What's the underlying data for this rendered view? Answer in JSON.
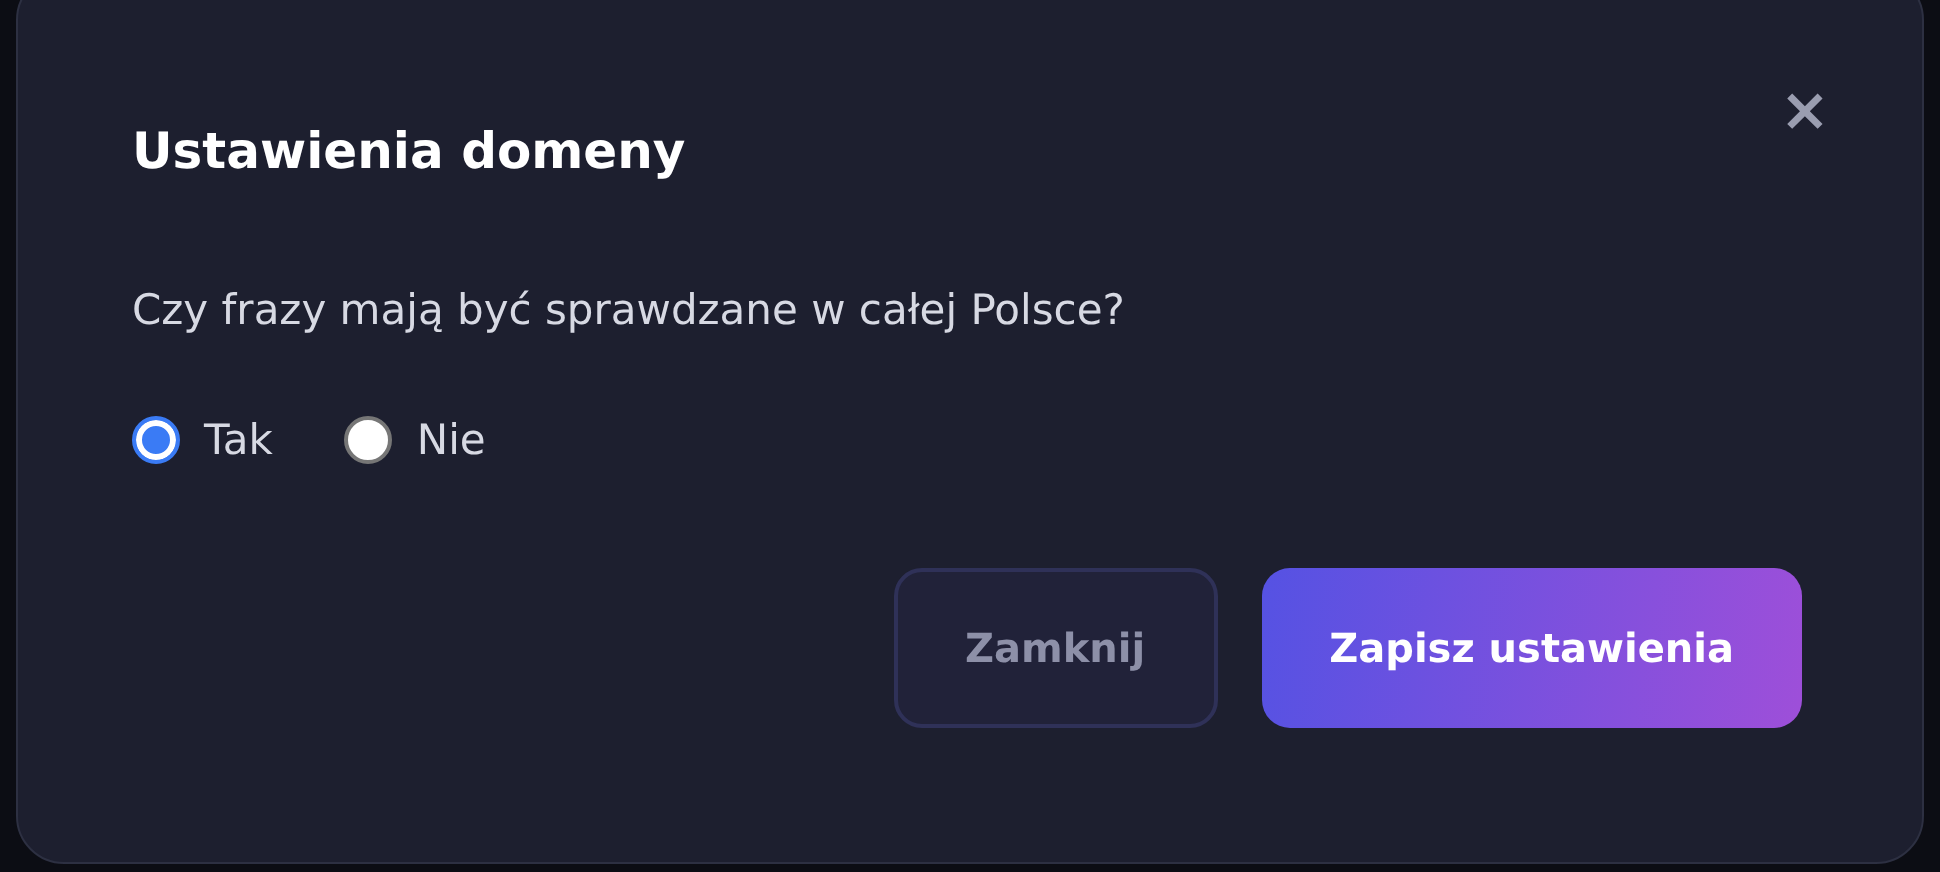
{
  "dialog": {
    "title": "Ustawienia domeny",
    "close_icon": "×"
  },
  "question": "Czy frazy mają być sprawdzane w całej Polsce?",
  "options": [
    {
      "label": "Tak",
      "selected": true
    },
    {
      "label": "Nie",
      "selected": false
    }
  ],
  "buttons": [
    {
      "label": "Zamknij",
      "kind": "secondary"
    },
    {
      "label": "Zapisz ustawienia",
      "kind": "primary"
    }
  ]
}
